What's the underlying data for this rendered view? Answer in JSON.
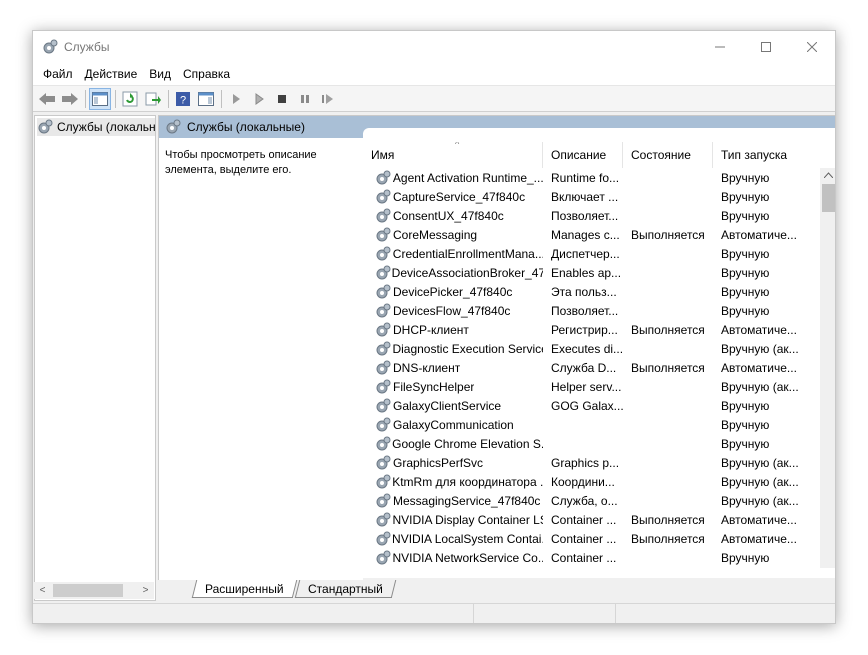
{
  "window": {
    "title": "Службы",
    "title_icon": "gear-icon"
  },
  "menu": [
    "Файл",
    "Действие",
    "Вид",
    "Справка"
  ],
  "tree": {
    "item_label": "Службы (локальны"
  },
  "header": {
    "title": "Службы (локальные)"
  },
  "description": {
    "text": "Чтобы просмотреть описание элемента, выделите его."
  },
  "columns": {
    "name": "Имя",
    "description": "Описание",
    "state": "Состояние",
    "startup": "Тип запуска"
  },
  "services": [
    {
      "name": "Agent Activation Runtime_...",
      "desc": "Runtime fo...",
      "state": "",
      "startup": "Вручную"
    },
    {
      "name": "CaptureService_47f840c",
      "desc": "Включает ...",
      "state": "",
      "startup": "Вручную"
    },
    {
      "name": "ConsentUX_47f840c",
      "desc": "Позволяет...",
      "state": "",
      "startup": "Вручную"
    },
    {
      "name": "CoreMessaging",
      "desc": "Manages c...",
      "state": "Выполняется",
      "startup": "Автоматиче..."
    },
    {
      "name": "CredentialEnrollmentMana...",
      "desc": "Диспетчер...",
      "state": "",
      "startup": "Вручную"
    },
    {
      "name": "DeviceAssociationBroker_47...",
      "desc": "Enables ap...",
      "state": "",
      "startup": "Вручную"
    },
    {
      "name": "DevicePicker_47f840c",
      "desc": "Эта польз...",
      "state": "",
      "startup": "Вручную"
    },
    {
      "name": "DevicesFlow_47f840c",
      "desc": "Позволяет...",
      "state": "",
      "startup": "Вручную"
    },
    {
      "name": "DHCP-клиент",
      "desc": "Регистрир...",
      "state": "Выполняется",
      "startup": "Автоматиче..."
    },
    {
      "name": "Diagnostic Execution Service",
      "desc": "Executes di...",
      "state": "",
      "startup": "Вручную (ак..."
    },
    {
      "name": "DNS-клиент",
      "desc": "Служба D...",
      "state": "Выполняется",
      "startup": "Автоматиче..."
    },
    {
      "name": "FileSyncHelper",
      "desc": "Helper serv...",
      "state": "",
      "startup": "Вручную (ак..."
    },
    {
      "name": "GalaxyClientService",
      "desc": "GOG Galax...",
      "state": "",
      "startup": "Вручную"
    },
    {
      "name": "GalaxyCommunication",
      "desc": "",
      "state": "",
      "startup": "Вручную"
    },
    {
      "name": "Google Chrome Elevation S...",
      "desc": "",
      "state": "",
      "startup": "Вручную"
    },
    {
      "name": "GraphicsPerfSvc",
      "desc": "Graphics p...",
      "state": "",
      "startup": "Вручную (ак..."
    },
    {
      "name": "KtmRm для координатора ...",
      "desc": "Координи...",
      "state": "",
      "startup": "Вручную (ак..."
    },
    {
      "name": "MessagingService_47f840c",
      "desc": "Служба, о...",
      "state": "",
      "startup": "Вручную (ак..."
    },
    {
      "name": "NVIDIA Display Container LS",
      "desc": "Container ...",
      "state": "Выполняется",
      "startup": "Автоматиче..."
    },
    {
      "name": "NVIDIA LocalSystem Contai...",
      "desc": "Container ...",
      "state": "Выполняется",
      "startup": "Автоматиче..."
    },
    {
      "name": "NVIDIA NetworkService Co...",
      "desc": "Container ...",
      "state": "",
      "startup": "Вручную"
    }
  ],
  "tabs": [
    "Расширенный",
    "Стандартный"
  ],
  "colors": {
    "header_band": "#a9bfd6",
    "selection": "#cfe3f7"
  }
}
